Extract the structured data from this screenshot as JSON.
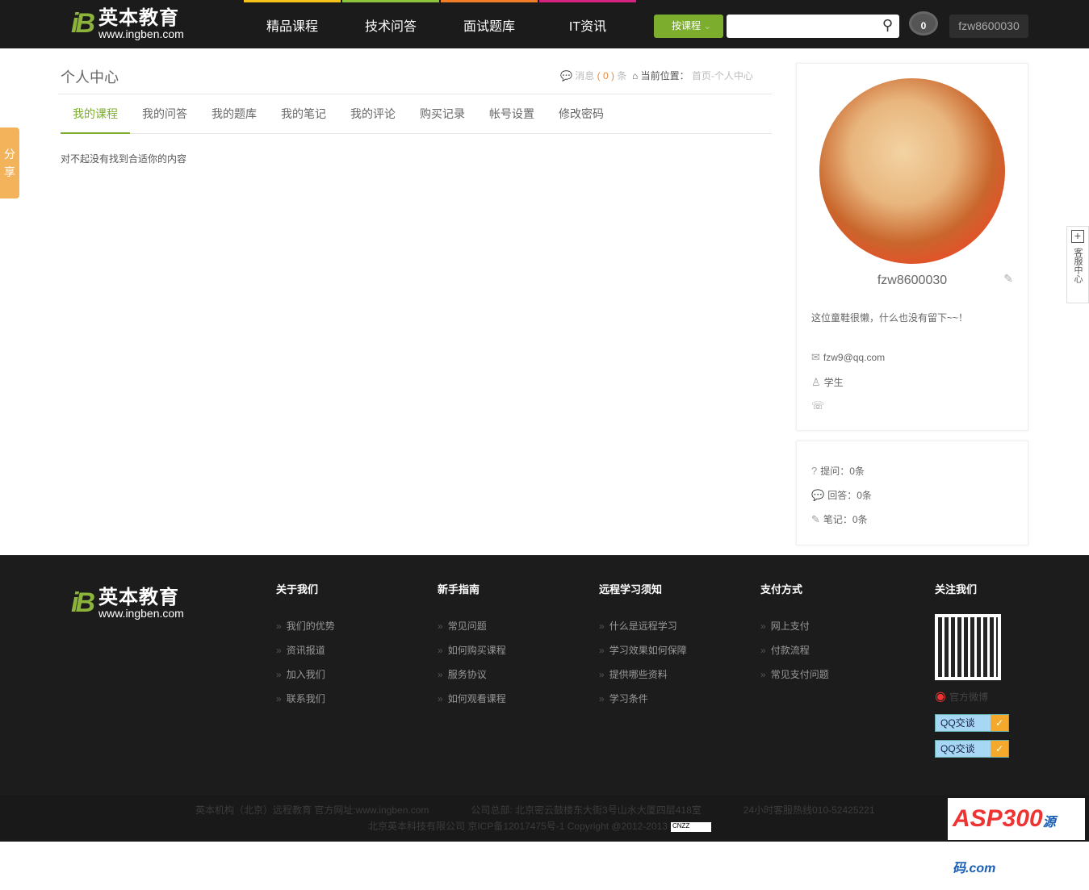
{
  "header": {
    "logo_cn": "英本教育",
    "logo_url": "www.ingben.com",
    "logo_mark": "iB",
    "nav": [
      {
        "label": "精品课程",
        "color": "#f4c21b"
      },
      {
        "label": "技术问答",
        "color": "#8cc43e"
      },
      {
        "label": "面试题库",
        "color": "#ef7d28"
      },
      {
        "label": "IT资讯",
        "color": "#d6237f"
      }
    ],
    "search_type": "按课程",
    "search_value": "",
    "messages": "0",
    "username": "fzw8600030"
  },
  "page": {
    "title": "个人中心",
    "msg_label": "消息",
    "msg_count": "( 0 )",
    "msg_unit": "条",
    "location_label": "当前位置：",
    "location": "首页-个人中心",
    "tabs": [
      "我的课程",
      "我的问答",
      "我的题库",
      "我的笔记",
      "我的评论",
      "购买记录",
      "帐号设置",
      "修改密码"
    ],
    "active_tab": 0,
    "empty": "对不起没有找到合适你的内容"
  },
  "share": "分享",
  "service": "客服中心",
  "profile": {
    "username": "fzw8600030",
    "bio": "这位童鞋很懒，什么也没有留下~~！",
    "email": "fzw9@qq.com",
    "role": "学生",
    "phone": "",
    "stats": [
      "提问：0条",
      "回答：0条",
      "笔记：0条"
    ]
  },
  "footer": {
    "columns": [
      {
        "title": "关于我们",
        "links": [
          "我们的优势",
          "资讯报道",
          "加入我们",
          "联系我们"
        ]
      },
      {
        "title": "新手指南",
        "links": [
          "常见问题",
          "如何购买课程",
          "服务协议",
          "如何观看课程"
        ]
      },
      {
        "title": "远程学习须知",
        "links": [
          "什么是远程学习",
          "学习效果如何保障",
          "提供哪些资料",
          "学习条件"
        ]
      },
      {
        "title": "支付方式",
        "links": [
          "网上支付",
          "付款流程",
          "常见支付问题"
        ]
      }
    ],
    "follow": "关注我们",
    "weibo": "官方微博",
    "qq": [
      "QQ交谈",
      "QQ交谈"
    ],
    "line1a": "英本机构（北京）远程教育 官方网址:www.ingben.com",
    "line1b": "公司总部: 北京密云鼓楼东大街3号山水大厦四层418室",
    "line1c": "24小时客服热线010-52425221",
    "line2": "北京英本科技有限公司 京ICP备12017475号-1 Copyright @2012-2013",
    "cnzz": "CNZZ",
    "badge": "ASP300源码.com"
  }
}
